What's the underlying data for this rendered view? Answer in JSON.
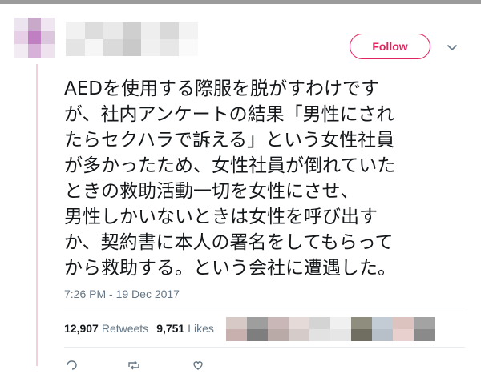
{
  "tweet": {
    "follow_label": "Follow",
    "text_lines": [
      "AEDを使用する際服を脱がすわけです",
      "が、社内アンケートの結果「男性にされ",
      "たらセクハラで訴える」という女性社員",
      "が多かったため、女性社員が倒れていた",
      "ときの救助活動一切を女性にさせ、",
      "男性しかいないときは女性を呼び出す",
      "か、契約書に本人の署名をしてもらって",
      "から救助する。という会社に遭遇した。"
    ],
    "timestamp": "7:26 PM - 19 Dec 2017",
    "retweets_count": "12,907",
    "retweets_label": "Retweets",
    "likes_count": "9,751",
    "likes_label": "Likes"
  },
  "colors": {
    "accent": "#e0245e",
    "muted_text": "#657786",
    "text": "#14171a",
    "thread_line": "#f6cfdc"
  },
  "icons": {
    "more": "chevron-down-icon",
    "reply": "reply-icon",
    "retweet": "retweet-icon",
    "like": "heart-icon"
  }
}
